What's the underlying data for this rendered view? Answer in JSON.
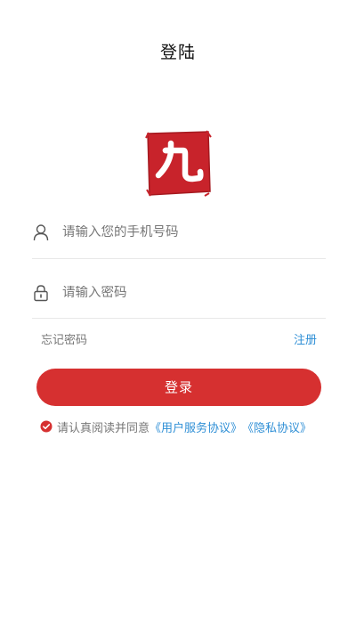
{
  "header": {
    "title": "登陆"
  },
  "logo": {
    "character": "九",
    "color": "#c8232b"
  },
  "phone": {
    "placeholder": "请输入您的手机号码",
    "icon": "user-icon"
  },
  "password": {
    "placeholder": "请输入密码",
    "icon": "lock-icon"
  },
  "links": {
    "forgot": "忘记密码",
    "register": "注册"
  },
  "login": {
    "label": "登录",
    "color": "#d63030"
  },
  "agreement": {
    "prefix": "请认真阅读并同意",
    "service": "《用户服务协议》",
    "privacy": "《隐私协议》",
    "checked": true
  }
}
